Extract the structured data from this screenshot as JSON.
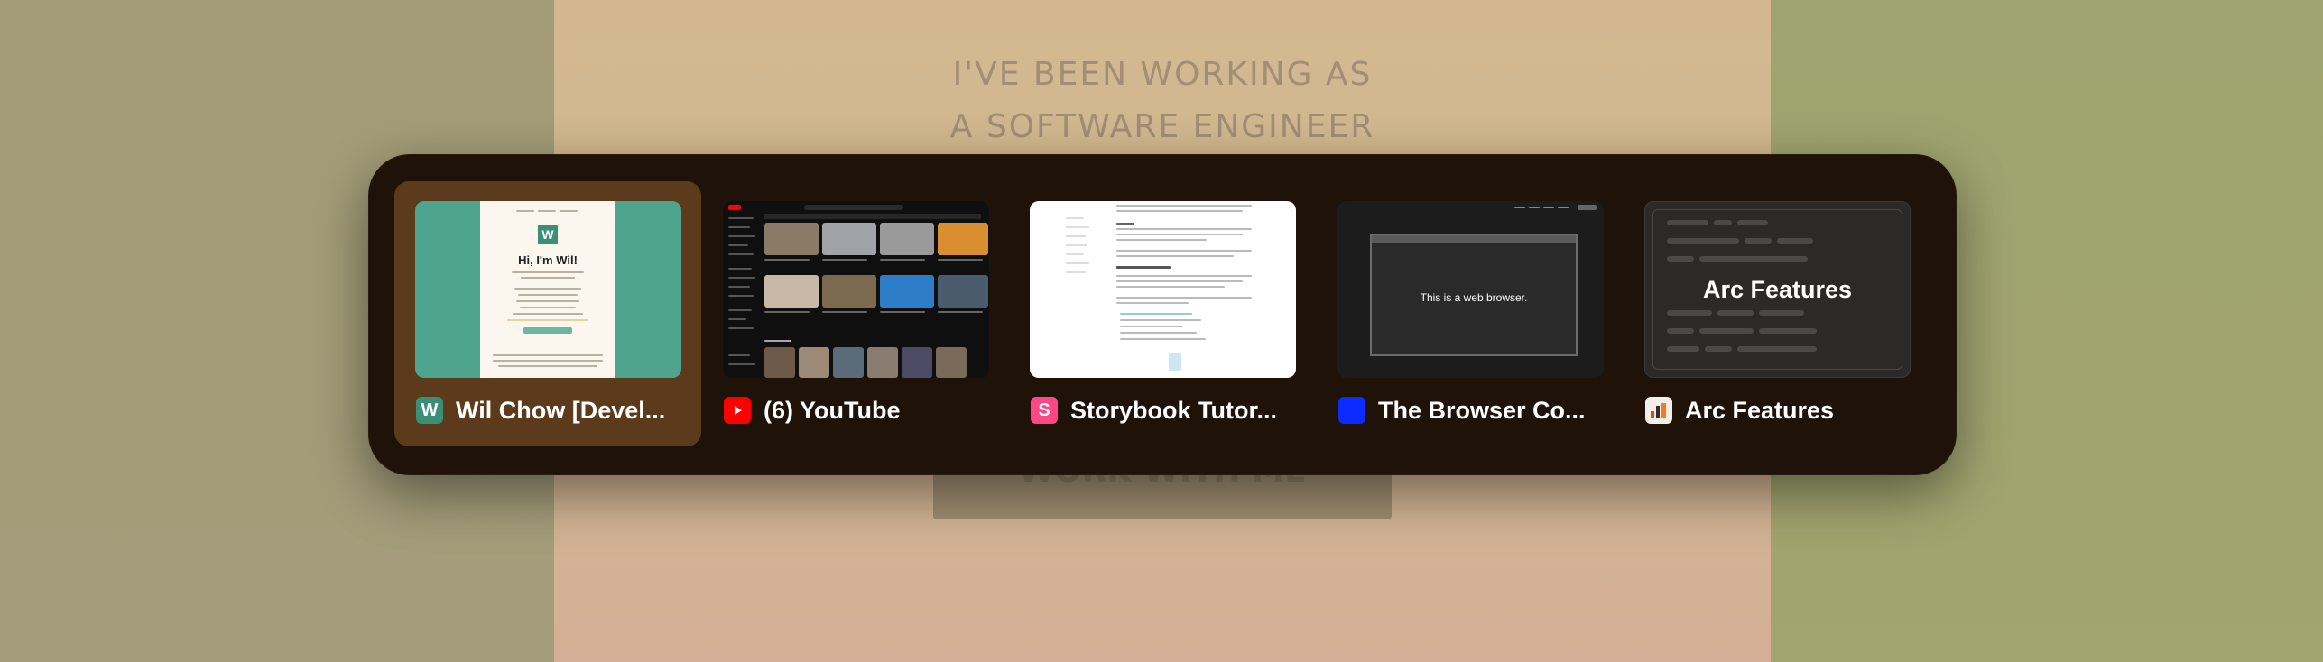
{
  "background": {
    "hero_line1": "I'VE BEEN WORKING AS",
    "hero_line2": "A SOFTWARE ENGINEER",
    "cta_label": "WORK WITH ME"
  },
  "switcher": {
    "tabs": [
      {
        "title": "Wil Chow [Devel...",
        "favicon": "wil-chow-w-icon",
        "favicon_letter": "W",
        "selected": true,
        "preview_heading": "Hi, I'm Wil!"
      },
      {
        "title": "(6) YouTube",
        "favicon": "youtube-play-icon",
        "selected": false
      },
      {
        "title": "Storybook Tutor...",
        "favicon": "storybook-s-icon",
        "favicon_letter": "S",
        "selected": false
      },
      {
        "title": "The Browser Co...",
        "favicon": "browser-company-square-icon",
        "selected": false,
        "preview_text": "This is a web browser."
      },
      {
        "title": "Arc Features",
        "favicon": "arc-features-icon",
        "selected": false,
        "preview_title": "Arc Features"
      }
    ]
  },
  "colors": {
    "switcher_bg": "#1f1209",
    "selected_tile": "#5c3a1c",
    "youtube_red": "#ff0000",
    "storybook_pink": "#ff4785",
    "browser_blue": "#0c2cff",
    "wil_green": "#3a8f75"
  }
}
